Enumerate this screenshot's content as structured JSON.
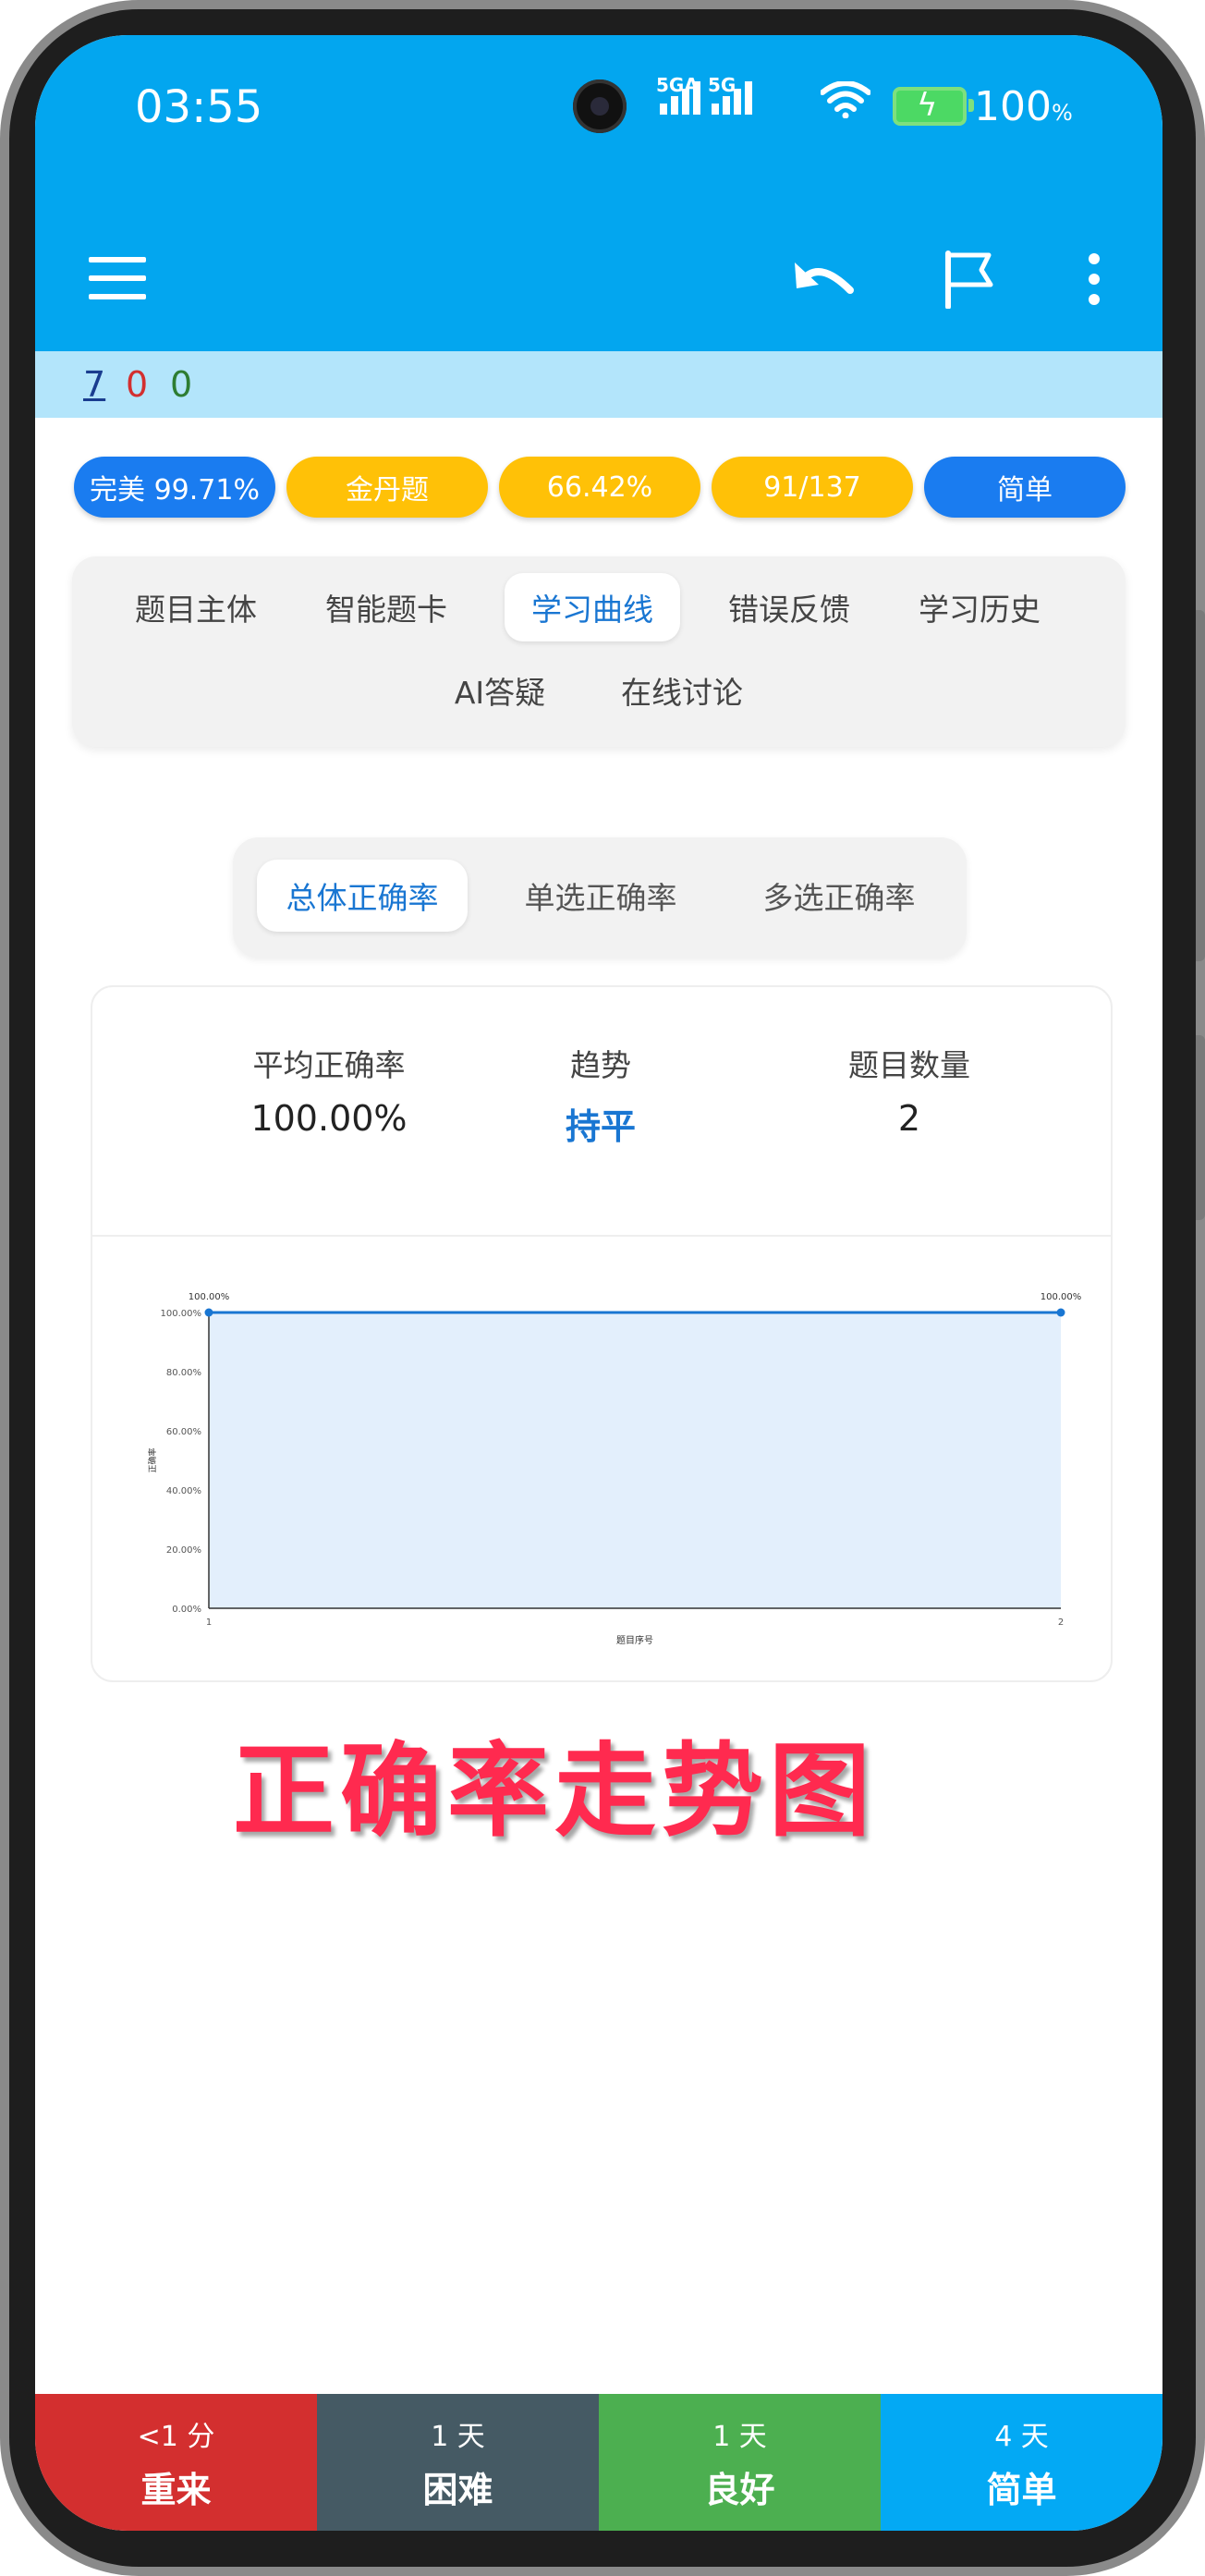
{
  "status_bar": {
    "time": "03:55",
    "signal1_label": "5GA",
    "signal2_label": "5G",
    "battery_percent": "100",
    "battery_unit": "%"
  },
  "counters": {
    "blue": "7",
    "red": "0",
    "green": "0"
  },
  "chips": [
    {
      "label": "完美 99.71%",
      "color": "#1a7cf0"
    },
    {
      "label": "金丹题",
      "color": "#ffc107"
    },
    {
      "label": "66.42%",
      "color": "#ffc107"
    },
    {
      "label": "91/137",
      "color": "#ffc107"
    },
    {
      "label": "简单",
      "color": "#1a7cf0"
    }
  ],
  "tabs": [
    {
      "label": "题目主体"
    },
    {
      "label": "智能题卡"
    },
    {
      "label": "学习曲线",
      "active": true
    },
    {
      "label": "错误反馈"
    },
    {
      "label": "学习历史"
    },
    {
      "label": "AI答疑"
    },
    {
      "label": "在线讨论"
    }
  ],
  "subtabs": [
    {
      "label": "总体正确率",
      "active": true
    },
    {
      "label": "单选正确率"
    },
    {
      "label": "多选正确率"
    }
  ],
  "stats": {
    "avg_label": "平均正确率",
    "avg_value": "100.00%",
    "trend_label": "趋势",
    "trend_value": "持平",
    "count_label": "题目数量",
    "count_value": "2"
  },
  "chart_data": {
    "type": "area",
    "x": [
      1,
      2
    ],
    "values": [
      100,
      100
    ],
    "point_labels": [
      "100.00%",
      "100.00%"
    ],
    "xlabel": "题目序号",
    "ylabel": "正确率",
    "ylim": [
      0,
      100
    ],
    "yticks": [
      "0.00%",
      "20.00%",
      "40.00%",
      "60.00%",
      "80.00%",
      "100.00%"
    ],
    "xticks": [
      "1",
      "2"
    ],
    "grid": true,
    "line_color": "#1976d2",
    "fill_color": "#e3effc"
  },
  "watermark": "正确率走势图",
  "bottom_buttons": [
    {
      "time": "<1 分",
      "label": "重来",
      "color": "#d32f2f"
    },
    {
      "time": "1 天",
      "label": "困难",
      "color": "#455a64"
    },
    {
      "time": "1 天",
      "label": "良好",
      "color": "#4caf50"
    },
    {
      "time": "4 天",
      "label": "简单",
      "color": "#03a9f4"
    }
  ]
}
